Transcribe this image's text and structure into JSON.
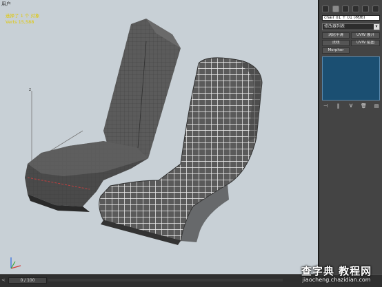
{
  "viewport": {
    "label": "用户",
    "stats": [
      "选择了 1 个 对象",
      "Verts  15,588"
    ]
  },
  "command_panel": {
    "object_name": "chair 01 + 01 (材质)",
    "modifier_list": "修改器列表",
    "buttons": {
      "smooth_mesh": "涡轮平滑",
      "uvw_unwrap": "UVW 展开",
      "normal": "法线",
      "uvw_map": "UVW 贴图",
      "morpher": "Morpher"
    }
  },
  "timeline": {
    "frame": "0 / 100",
    "left_marker": "<"
  },
  "watermark": {
    "title": "查字典 教程网",
    "url": "jiaocheng.chazidian.com"
  },
  "icons": {
    "pin-stack": "⊣",
    "show-end-result": "‖",
    "make-unique": "∀",
    "remove-modifier": "🗑",
    "configure-sets": "▤"
  },
  "colors": {
    "viewport_bg": "#c8d0d6",
    "stack_bg": "#1b4f72",
    "stats_text": "#e0c800"
  }
}
